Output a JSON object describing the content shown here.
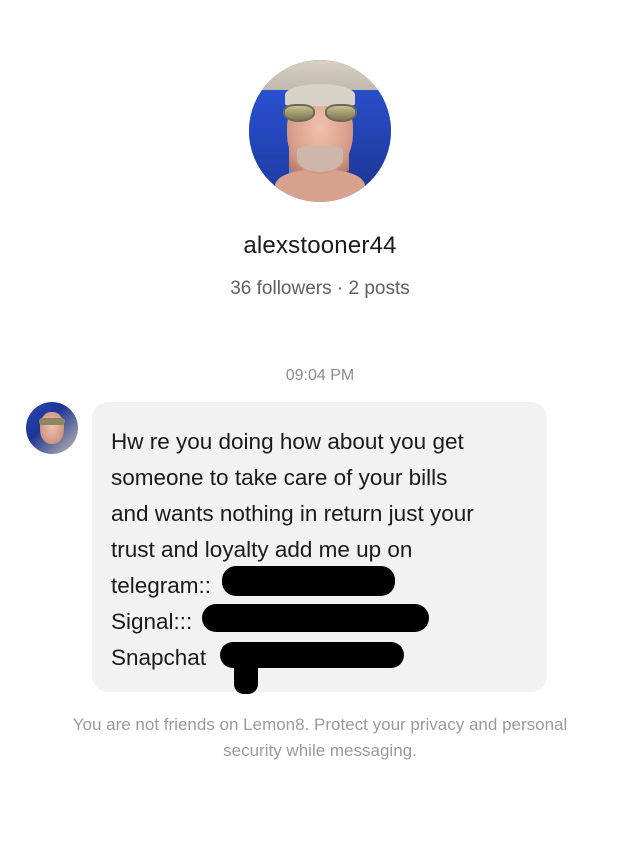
{
  "profile": {
    "username": "alexstooner44",
    "stats": "36 followers · 2 posts"
  },
  "conversation": {
    "timestamp": "09:04 PM",
    "message_lines": [
      "Hw re you doing how about you get",
      "someone to take care of your bills",
      "and wants nothing in return just your",
      "trust and loyalty add me up on",
      "telegram::",
      "Signal:::",
      "Snapchat"
    ]
  },
  "footer": {
    "notice_line1": "You are not friends on Lemon8. Protect your privacy and personal",
    "notice_line2": "security while messaging."
  }
}
